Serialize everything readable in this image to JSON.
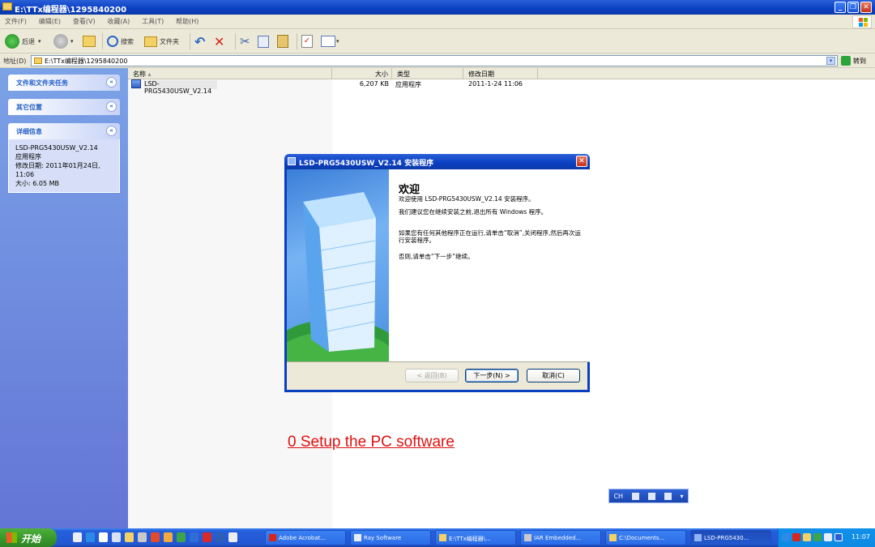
{
  "window": {
    "title": "E:\\TTx编程器\\1295840200",
    "min_glyph": "_",
    "max_glyph": "❐",
    "close_glyph": "✕"
  },
  "menu": [
    "文件(F)",
    "编辑(E)",
    "查看(V)",
    "收藏(A)",
    "工具(T)",
    "帮助(H)"
  ],
  "toolbar": {
    "back_label": "后退",
    "search_label": "搜索",
    "folders_label": "文件夹"
  },
  "address": {
    "label": "地址(D)",
    "value": "E:\\TTx编程器\\1295840200",
    "go_label": "转到"
  },
  "left_pane": {
    "panels": [
      {
        "title": "文件和文件夹任务"
      },
      {
        "title": "其它位置"
      },
      {
        "title": "详细信息",
        "lines": [
          "LSD-PRG5430USW_V2.14",
          "应用程序",
          "修改日期: 2011年01月24日,",
          "11:06",
          "大小: 6.05 MB"
        ]
      }
    ]
  },
  "file_list": {
    "columns": [
      "名称",
      "大小",
      "类型",
      "修改日期"
    ],
    "rows": [
      {
        "name": "LSD-PRG5430USW_V2.14",
        "size": "6,207 KB",
        "type": "应用程序",
        "modified": "2011-1-24 11:06"
      }
    ]
  },
  "dialog": {
    "title": "LSD-PRG5430USW_V2.14 安装程序",
    "heading": "欢迎",
    "paragraphs": [
      "欢迎使用 LSD-PRG5430USW_V2.14 安装程序。",
      "我们建议您在继续安装之前,退出所有 Windows 程序。",
      "如果您有任何其他程序正在运行,请单击“取消”,关闭程序,然后再次运行安装程序。",
      "否则,请单击“下一步”继续。"
    ],
    "buttons": {
      "back": "< 返回(B)",
      "next": "下一步(N) >",
      "cancel": "取消(C)"
    }
  },
  "overlay_link": "0 Setup the PC software",
  "language_bar": {
    "label": "CH"
  },
  "taskbar": {
    "start_label": "开始",
    "tasks": [
      "Adobe Acrobat...",
      "Ray Software",
      "E:\\TTx编程器\\...",
      "IAR Embedded...",
      "C:\\Documents...",
      "LSD-PRG5430..."
    ],
    "clock": "11:07"
  },
  "colors": {
    "xp_blue": "#0a3fc1",
    "left_pane_top": "#7ba2e7",
    "left_pane_bottom": "#6375d6",
    "start_green": "#3a9a2c",
    "link_red": "#e01010"
  }
}
